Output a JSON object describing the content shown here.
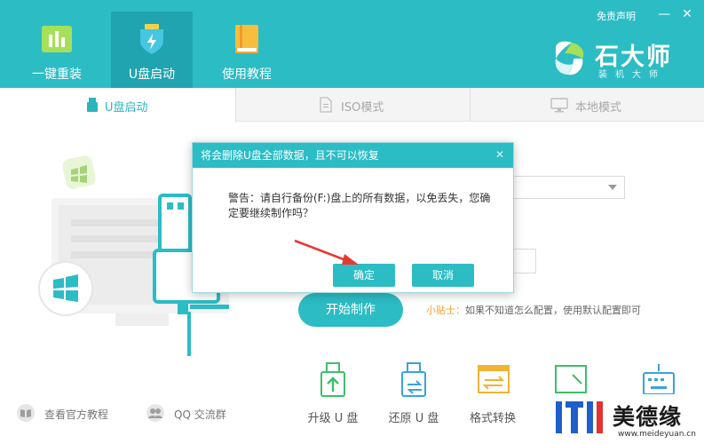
{
  "header": {
    "nav": [
      {
        "label": "一键重装",
        "icon": "bar-chart-icon"
      },
      {
        "label": "U盘启动",
        "icon": "usb-shield-icon"
      },
      {
        "label": "使用教程",
        "icon": "book-icon"
      }
    ],
    "active_nav": 1,
    "disclaimer": "免责声明",
    "logo": {
      "title": "石大师",
      "subtitle": "装机大师"
    },
    "window_controls": {
      "minimize": "—",
      "close": "✕"
    }
  },
  "mode_tabs": [
    {
      "label": "U盘启动",
      "icon": "usb-drive-icon",
      "active": true
    },
    {
      "label": "ISO模式",
      "icon": "iso-file-icon",
      "active": false
    },
    {
      "label": "本地模式",
      "icon": "monitor-icon",
      "active": false
    }
  ],
  "main": {
    "start_button": "开始制作",
    "tip_prefix": "小贴士：",
    "tip_text": "如果不知道怎么配置，使用默认配置即可"
  },
  "bottom_links": [
    {
      "label": "查看官方教程",
      "icon": "book-open-icon"
    },
    {
      "label": "QQ 交流群",
      "icon": "group-icon"
    }
  ],
  "tools": [
    {
      "label": "升级 U 盘",
      "icon": "usb-upgrade-icon"
    },
    {
      "label": "还原 U 盘",
      "icon": "usb-restore-icon"
    },
    {
      "label": "格式转换",
      "icon": "format-convert-icon"
    },
    {
      "label": "",
      "icon": "partition-icon"
    },
    {
      "label": "",
      "icon": "keyboard-icon"
    }
  ],
  "dialog": {
    "title": "将会删除U盘全部数据，且不可以恢复",
    "close": "✕",
    "message": "警告：请自行备份(F:)盘上的所有数据，以免丢失，您确定要继续制作吗？",
    "confirm": "确定",
    "cancel": "取消"
  },
  "watermark": {
    "name": "美德缘",
    "url": "www.meideyuan.cn"
  },
  "colors": {
    "primary": "#2cbcc4",
    "primary_dark": "#1fa4b0",
    "tip_orange": "#f2a338",
    "arrow_red": "#e53935"
  }
}
